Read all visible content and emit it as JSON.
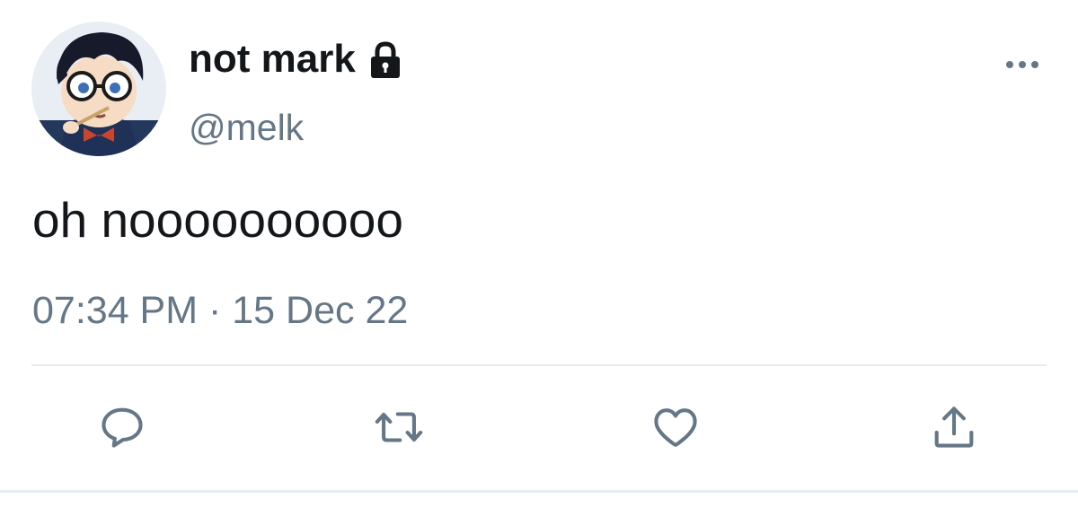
{
  "tweet": {
    "display_name": "not mark",
    "handle": "@melk",
    "text": "oh noooooooooo",
    "timestamp": "07:34 PM · 15 Dec 22",
    "account_protected": true
  },
  "icons": {
    "lock": "lock-icon",
    "more": "more-options-icon",
    "reply": "reply-icon",
    "retweet": "retweet-icon",
    "like": "like-icon",
    "share": "share-icon"
  },
  "colors": {
    "text_primary": "#14171a",
    "text_secondary": "#657786",
    "divider": "#e6ecf0",
    "action_icon": "#657786"
  }
}
